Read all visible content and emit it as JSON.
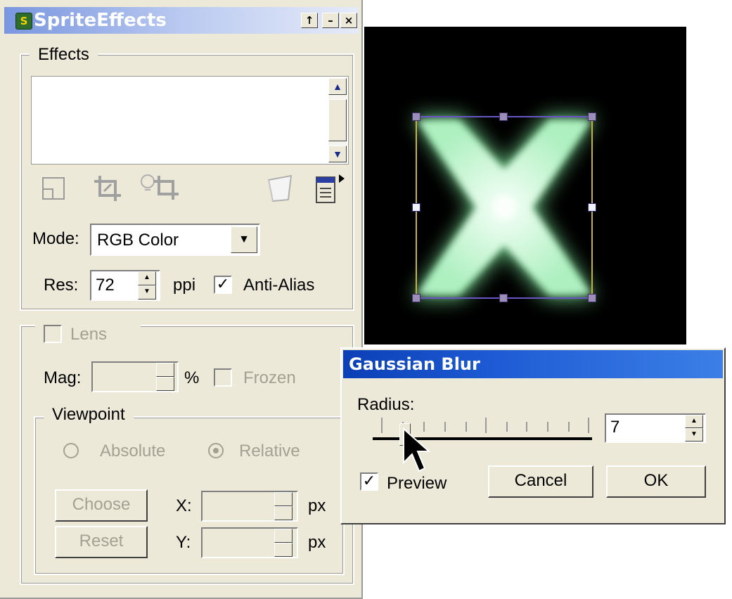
{
  "panel": {
    "title": "SpriteEffects",
    "title_buttons": {
      "restore": "↑",
      "minimize": "–",
      "close": "×"
    },
    "effects_group": "Effects",
    "toolbar_icons": [
      "new-layer-icon",
      "crop-icon",
      "lightbulb-crop-icon",
      "bucket-icon",
      "menu-page-icon"
    ],
    "mode_label": "Mode:",
    "mode_value": "RGB Color",
    "res_label": "Res:",
    "res_value": "72",
    "res_unit": "ppi",
    "anti_alias_label": "Anti-Alias",
    "anti_alias_checked": true,
    "lens_label": "Lens",
    "mag_label": "Mag:",
    "mag_unit": "%",
    "frozen_label": "Frozen",
    "viewpoint_label": "Viewpoint",
    "absolute_label": "Absolute",
    "relative_label": "Relative",
    "choose_label": "Choose",
    "reset_label": "Reset",
    "x_label": "X:",
    "y_label": "Y:",
    "px_unit": "px"
  },
  "canvas": {
    "background": "#000000",
    "glyph": "X",
    "glow_color": "#b8f5c8"
  },
  "dialog": {
    "title": "Gaussian Blur",
    "radius_label": "Radius:",
    "radius_value": "7",
    "preview_label": "Preview",
    "preview_checked": true,
    "cancel_label": "Cancel",
    "ok_label": "OK",
    "title_color": "#0b3fb6"
  }
}
